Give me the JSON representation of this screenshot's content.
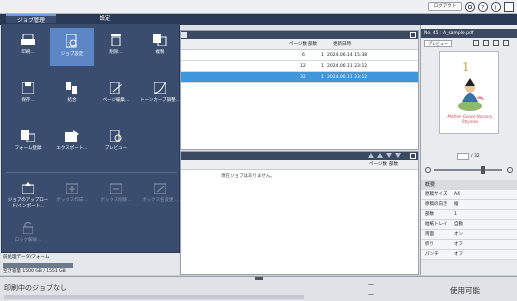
{
  "header": {
    "logout_label": "ログアウト"
  },
  "tabs": [
    {
      "label": "ジョブ管理"
    },
    {
      "label": "設定"
    }
  ],
  "menu": {
    "items": [
      {
        "label": "印刷..."
      },
      {
        "label": "ジョブ設定"
      },
      {
        "label": "削除..."
      },
      {
        "label": "複製"
      },
      {
        "label": "保存..."
      },
      {
        "label": "結合"
      },
      {
        "label": "ページ編集..."
      },
      {
        "label": "トーンカーブ調整..."
      },
      {
        "label": "フォーム登録"
      },
      {
        "label": "エクスポート..."
      },
      {
        "label": "プレビュー"
      },
      {
        "label": "ジョブのアップロード/インポート..."
      },
      {
        "label": "ボックス作成..."
      },
      {
        "label": "ボックス削除..."
      },
      {
        "label": "ボックス名変更..."
      },
      {
        "label": "ロック解除..."
      }
    ]
  },
  "job_table": {
    "headers": [
      "ページ数",
      "部数",
      "更新日時"
    ],
    "rows": [
      {
        "pages": "6",
        "copies": "1",
        "date": "2024.06.14 15:38",
        "selected": false
      },
      {
        "pages": "12",
        "copies": "1",
        "date": "2024.06.11 23:12",
        "selected": false
      },
      {
        "pages": "32",
        "copies": "1",
        "date": "2024.06.11 23:12",
        "selected": true
      }
    ]
  },
  "lower_panel": {
    "headers": [
      "ページ数",
      "部数"
    ],
    "empty_message": "現在ジョブはありません。"
  },
  "left_status": {
    "form_label": "前処理データ/フォーム",
    "disk_info": "空き容量 1500 GB / 1551 GB"
  },
  "preview": {
    "title": "No. 45 : A_sample.pdf",
    "button_label": "プレビュー",
    "page_number": "1",
    "page_total": "/ 32",
    "thumb_caption": "Mother Goose Nursery Rhymes"
  },
  "overview": {
    "heading": "概要",
    "rows": [
      {
        "key": "原稿サイズ",
        "value": "A4"
      },
      {
        "key": "原稿の向き",
        "value": "縦"
      },
      {
        "key": "部数",
        "value": "1"
      },
      {
        "key": "給紙トレイ",
        "value": "自動"
      },
      {
        "key": "両面",
        "value": "オン"
      },
      {
        "key": "折り",
        "value": "オフ"
      },
      {
        "key": "パンチ",
        "value": "オフ"
      }
    ]
  },
  "status_bar": {
    "printing": "印刷中のジョブなし",
    "dash1": "—",
    "dash2": "—",
    "state": "使用可能"
  },
  "colors": {
    "menu_bg": "#3a4d6e",
    "menu_active": "#5c86c4",
    "row_selected": "#3f96da",
    "tab_bg": "#2a3a54"
  }
}
